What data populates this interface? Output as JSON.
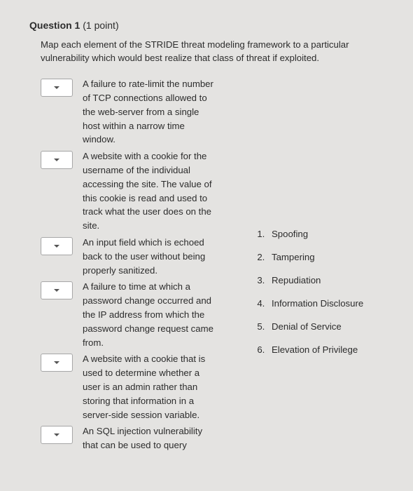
{
  "question": {
    "number_label": "Question 1",
    "points_label": "(1 point)",
    "prompt": "Map each element of the STRIDE threat modeling framework to a particular vulnerability which would best realize that class of threat if exploited."
  },
  "match_items": [
    {
      "text": "A failure to rate-limit the number of TCP connections allowed to the web-server from a single host within a narrow time window."
    },
    {
      "text": "A website with a cookie for the username of the individual accessing the site. The value of this cookie is read and used to track what the user does on the site."
    },
    {
      "text": "An input field which is echoed back to the user without being properly sanitized."
    },
    {
      "text": "A failure to time at which a password change occurred and the IP address from which the password change request came from."
    },
    {
      "text": "A website with a cookie that is used to determine whether a user is an admin rather than storing that information in a server-side session variable."
    },
    {
      "text": "An SQL injection vulnerability that can be used to query"
    }
  ],
  "answer_options": [
    "Spoofing",
    "Tampering",
    "Repudiation",
    "Information Disclosure",
    "Denial of Service",
    "Elevation of Privilege"
  ]
}
